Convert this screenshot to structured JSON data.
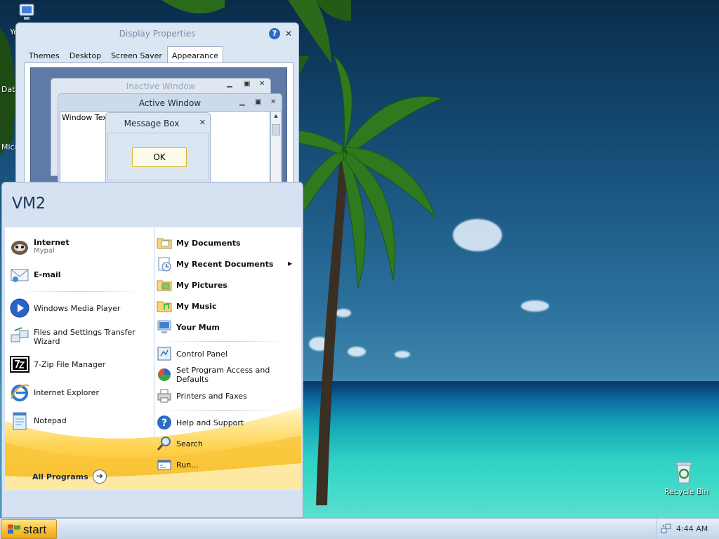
{
  "desktop": {
    "icons": [
      {
        "label": "Yo"
      },
      {
        "label": "Data"
      },
      {
        "label": "Micro"
      },
      {
        "label": "Recycle Bin"
      }
    ]
  },
  "display_properties": {
    "title": "Display Properties",
    "help_glyph": "?",
    "close_glyph": "✕",
    "tabs": [
      "Themes",
      "Desktop",
      "Screen Saver",
      "Appearance"
    ],
    "active_tab": "Appearance",
    "preview": {
      "inactive_title": "Inactive Window",
      "active_title": "Active Window",
      "window_text": "Window Text",
      "message_box_title": "Message Box",
      "ok_label": "OK"
    }
  },
  "start_menu": {
    "user": "VM2",
    "pinned": [
      {
        "label": "Internet",
        "sub": "Mypal"
      },
      {
        "label": "E-mail"
      }
    ],
    "recent": [
      {
        "label": "Windows Media Player"
      },
      {
        "label": "Files and Settings Transfer",
        "label2": "Wizard"
      },
      {
        "label": "7-Zip File Manager"
      },
      {
        "label": "Internet Explorer"
      },
      {
        "label": "Notepad"
      }
    ],
    "all_programs": "All Programs",
    "right_top": [
      {
        "label": "My Documents"
      },
      {
        "label": "My Recent Documents"
      },
      {
        "label": "My Pictures"
      },
      {
        "label": "My Music"
      },
      {
        "label": "Your Mum"
      }
    ],
    "right_mid": [
      {
        "label": "Control Panel"
      },
      {
        "label": "Set Program Access and",
        "label2": "Defaults"
      },
      {
        "label": "Printers and Faxes"
      }
    ],
    "right_bottom": [
      {
        "label": "Help and Support"
      },
      {
        "label": "Search"
      },
      {
        "label": "Run..."
      }
    ]
  },
  "taskbar": {
    "start_label": "start",
    "clock": "4:44 AM"
  },
  "colors": {
    "taskbar": "#d2e0f0",
    "start_button": "#f8c33c",
    "menu_frame": "#d6e2f2"
  }
}
